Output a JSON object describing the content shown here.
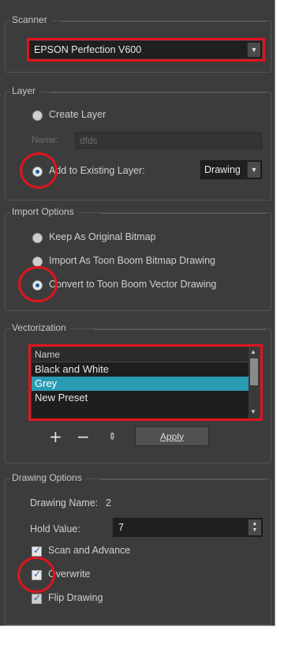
{
  "scanner": {
    "title": "Scanner",
    "device": "EPSON Perfection V600"
  },
  "layer": {
    "title": "Layer",
    "create_layer": "Create Layer",
    "name_label": "Name:",
    "name_value": "dfds",
    "add_to_existing": "Add to Existing Layer:",
    "existing_layer": "Drawing"
  },
  "import_options": {
    "title": "Import Options",
    "keep_bitmap": "Keep As Original Bitmap",
    "import_toon_bitmap": "Import As Toon Boom Bitmap Drawing",
    "convert_vector": "Convert to Toon Boom Vector Drawing"
  },
  "vectorization": {
    "title": "Vectorization",
    "header": "Name",
    "presets": [
      "Black and White",
      "Grey",
      "New Preset"
    ],
    "selected": "Grey",
    "apply_label": "Apply"
  },
  "drawing_options": {
    "title": "Drawing Options",
    "drawing_name_label": "Drawing Name:",
    "drawing_name_value": "2",
    "hold_value_label": "Hold Value:",
    "hold_value": "7",
    "scan_and_advance": "Scan and Advance",
    "overwrite": "Overwrite",
    "flip_drawing": "Flip Drawing"
  },
  "colors": {
    "panel_bg": "#3c3c3c",
    "highlight": "#e0141e",
    "selection": "#2a9bb3"
  }
}
